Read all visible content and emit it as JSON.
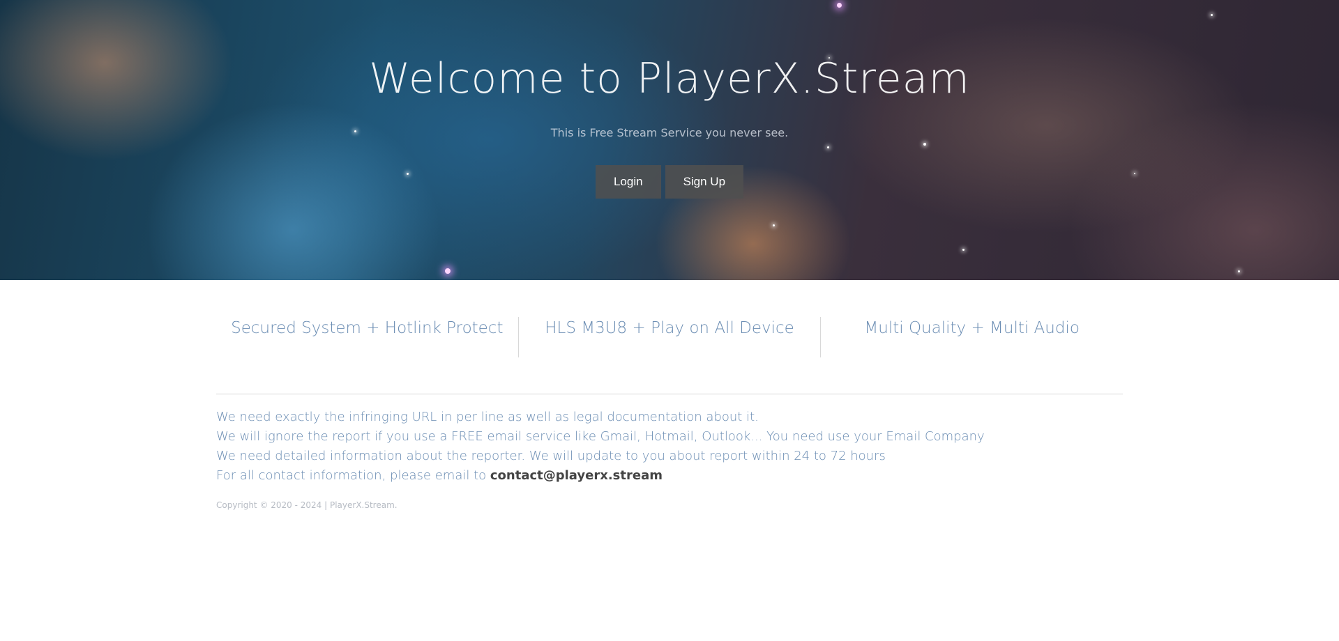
{
  "hero": {
    "title": "Welcome to PlayerX.Stream",
    "subtitle": "This is Free Stream Service you never see.",
    "login_label": "Login",
    "signup_label": "Sign Up"
  },
  "features": [
    {
      "label": "Secured System + Hotlink Protect"
    },
    {
      "label": "HLS M3U8 + Play on All Device"
    },
    {
      "label": "Multi Quality + Multi Audio"
    }
  ],
  "notes": {
    "line1": "We need exactly the infringing URL in per line as well as legal documentation about it.",
    "line2": "We will ignore the report if you use a FREE email service like Gmail, Hotmail, Outlook... You need use your Email Company",
    "line3": "We need detailed information about the reporter. We will update to you about report within 24 to 72 hours",
    "line4_prefix": "For all contact information, please email to ",
    "email": "contact@playerx.stream"
  },
  "footer": {
    "copyright": "Copyright © 2020 - 2024 | PlayerX.Stream."
  },
  "colors": {
    "feature_text": "#6b8db3",
    "button_bg": "#505050",
    "email_text": "#444444"
  }
}
